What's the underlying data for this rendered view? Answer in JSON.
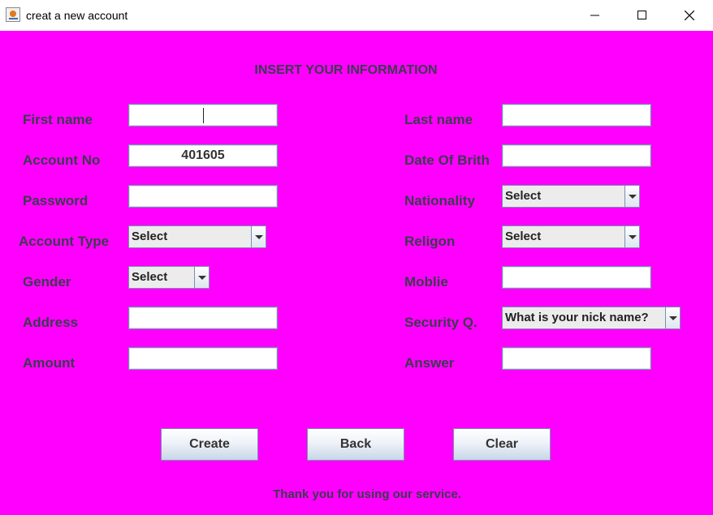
{
  "window": {
    "title": "creat a new account",
    "icon": "java-cup-icon"
  },
  "heading": "INSERT YOUR INFORMATION",
  "left_fields": {
    "first_name": {
      "label": "First name",
      "value": ""
    },
    "account_no": {
      "label": "Account No",
      "value": "401605"
    },
    "password": {
      "label": "Password",
      "value": ""
    },
    "account_type": {
      "label": "Account Type",
      "value": "Select"
    },
    "gender": {
      "label": "Gender",
      "value": "Select"
    },
    "address": {
      "label": "Address",
      "value": ""
    },
    "amount": {
      "label": "Amount",
      "value": ""
    }
  },
  "right_fields": {
    "last_name": {
      "label": "Last name",
      "value": ""
    },
    "date_of_birth": {
      "label": "Date Of Brith",
      "value": ""
    },
    "nationality": {
      "label": "Nationality",
      "value": "Select"
    },
    "religion": {
      "label": "Religon",
      "value": "Select"
    },
    "mobile": {
      "label": "Moblie",
      "value": ""
    },
    "security_q": {
      "label": "Security Q.",
      "value": "What is your nick name?"
    },
    "answer": {
      "label": "Answer",
      "value": ""
    }
  },
  "buttons": {
    "create": "Create",
    "back": "Back",
    "clear": "Clear"
  },
  "footer": "Thank you for using our service.",
  "colors": {
    "background": "#ff00ff",
    "label_text": "#3b3b4f"
  }
}
